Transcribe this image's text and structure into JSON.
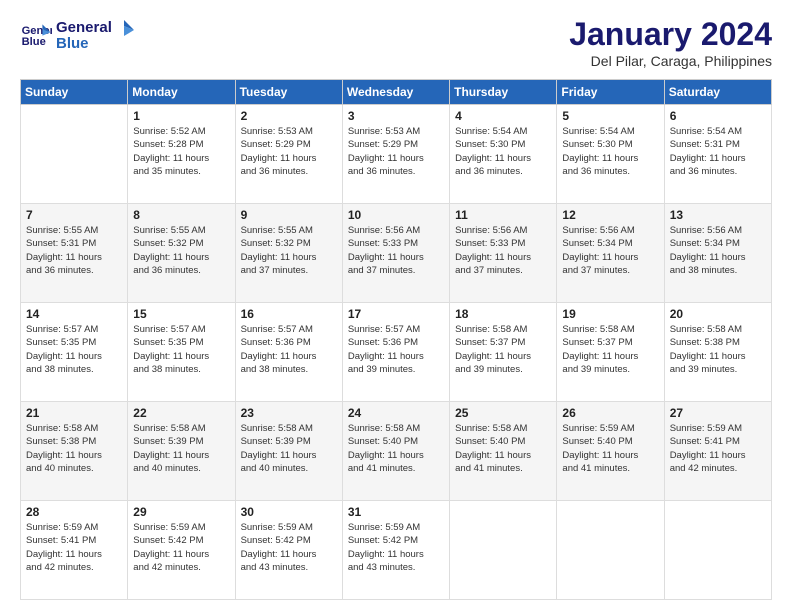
{
  "logo": {
    "line1": "General",
    "line2": "Blue"
  },
  "title": "January 2024",
  "subtitle": "Del Pilar, Caraga, Philippines",
  "weekdays": [
    "Sunday",
    "Monday",
    "Tuesday",
    "Wednesday",
    "Thursday",
    "Friday",
    "Saturday"
  ],
  "weeks": [
    [
      {
        "day": "",
        "info": ""
      },
      {
        "day": "1",
        "info": "Sunrise: 5:52 AM\nSunset: 5:28 PM\nDaylight: 11 hours\nand 35 minutes."
      },
      {
        "day": "2",
        "info": "Sunrise: 5:53 AM\nSunset: 5:29 PM\nDaylight: 11 hours\nand 36 minutes."
      },
      {
        "day": "3",
        "info": "Sunrise: 5:53 AM\nSunset: 5:29 PM\nDaylight: 11 hours\nand 36 minutes."
      },
      {
        "day": "4",
        "info": "Sunrise: 5:54 AM\nSunset: 5:30 PM\nDaylight: 11 hours\nand 36 minutes."
      },
      {
        "day": "5",
        "info": "Sunrise: 5:54 AM\nSunset: 5:30 PM\nDaylight: 11 hours\nand 36 minutes."
      },
      {
        "day": "6",
        "info": "Sunrise: 5:54 AM\nSunset: 5:31 PM\nDaylight: 11 hours\nand 36 minutes."
      }
    ],
    [
      {
        "day": "7",
        "info": "Sunrise: 5:55 AM\nSunset: 5:31 PM\nDaylight: 11 hours\nand 36 minutes."
      },
      {
        "day": "8",
        "info": "Sunrise: 5:55 AM\nSunset: 5:32 PM\nDaylight: 11 hours\nand 36 minutes."
      },
      {
        "day": "9",
        "info": "Sunrise: 5:55 AM\nSunset: 5:32 PM\nDaylight: 11 hours\nand 37 minutes."
      },
      {
        "day": "10",
        "info": "Sunrise: 5:56 AM\nSunset: 5:33 PM\nDaylight: 11 hours\nand 37 minutes."
      },
      {
        "day": "11",
        "info": "Sunrise: 5:56 AM\nSunset: 5:33 PM\nDaylight: 11 hours\nand 37 minutes."
      },
      {
        "day": "12",
        "info": "Sunrise: 5:56 AM\nSunset: 5:34 PM\nDaylight: 11 hours\nand 37 minutes."
      },
      {
        "day": "13",
        "info": "Sunrise: 5:56 AM\nSunset: 5:34 PM\nDaylight: 11 hours\nand 38 minutes."
      }
    ],
    [
      {
        "day": "14",
        "info": "Sunrise: 5:57 AM\nSunset: 5:35 PM\nDaylight: 11 hours\nand 38 minutes."
      },
      {
        "day": "15",
        "info": "Sunrise: 5:57 AM\nSunset: 5:35 PM\nDaylight: 11 hours\nand 38 minutes."
      },
      {
        "day": "16",
        "info": "Sunrise: 5:57 AM\nSunset: 5:36 PM\nDaylight: 11 hours\nand 38 minutes."
      },
      {
        "day": "17",
        "info": "Sunrise: 5:57 AM\nSunset: 5:36 PM\nDaylight: 11 hours\nand 39 minutes."
      },
      {
        "day": "18",
        "info": "Sunrise: 5:58 AM\nSunset: 5:37 PM\nDaylight: 11 hours\nand 39 minutes."
      },
      {
        "day": "19",
        "info": "Sunrise: 5:58 AM\nSunset: 5:37 PM\nDaylight: 11 hours\nand 39 minutes."
      },
      {
        "day": "20",
        "info": "Sunrise: 5:58 AM\nSunset: 5:38 PM\nDaylight: 11 hours\nand 39 minutes."
      }
    ],
    [
      {
        "day": "21",
        "info": "Sunrise: 5:58 AM\nSunset: 5:38 PM\nDaylight: 11 hours\nand 40 minutes."
      },
      {
        "day": "22",
        "info": "Sunrise: 5:58 AM\nSunset: 5:39 PM\nDaylight: 11 hours\nand 40 minutes."
      },
      {
        "day": "23",
        "info": "Sunrise: 5:58 AM\nSunset: 5:39 PM\nDaylight: 11 hours\nand 40 minutes."
      },
      {
        "day": "24",
        "info": "Sunrise: 5:58 AM\nSunset: 5:40 PM\nDaylight: 11 hours\nand 41 minutes."
      },
      {
        "day": "25",
        "info": "Sunrise: 5:58 AM\nSunset: 5:40 PM\nDaylight: 11 hours\nand 41 minutes."
      },
      {
        "day": "26",
        "info": "Sunrise: 5:59 AM\nSunset: 5:40 PM\nDaylight: 11 hours\nand 41 minutes."
      },
      {
        "day": "27",
        "info": "Sunrise: 5:59 AM\nSunset: 5:41 PM\nDaylight: 11 hours\nand 42 minutes."
      }
    ],
    [
      {
        "day": "28",
        "info": "Sunrise: 5:59 AM\nSunset: 5:41 PM\nDaylight: 11 hours\nand 42 minutes."
      },
      {
        "day": "29",
        "info": "Sunrise: 5:59 AM\nSunset: 5:42 PM\nDaylight: 11 hours\nand 42 minutes."
      },
      {
        "day": "30",
        "info": "Sunrise: 5:59 AM\nSunset: 5:42 PM\nDaylight: 11 hours\nand 43 minutes."
      },
      {
        "day": "31",
        "info": "Sunrise: 5:59 AM\nSunset: 5:42 PM\nDaylight: 11 hours\nand 43 minutes."
      },
      {
        "day": "",
        "info": ""
      },
      {
        "day": "",
        "info": ""
      },
      {
        "day": "",
        "info": ""
      }
    ]
  ]
}
